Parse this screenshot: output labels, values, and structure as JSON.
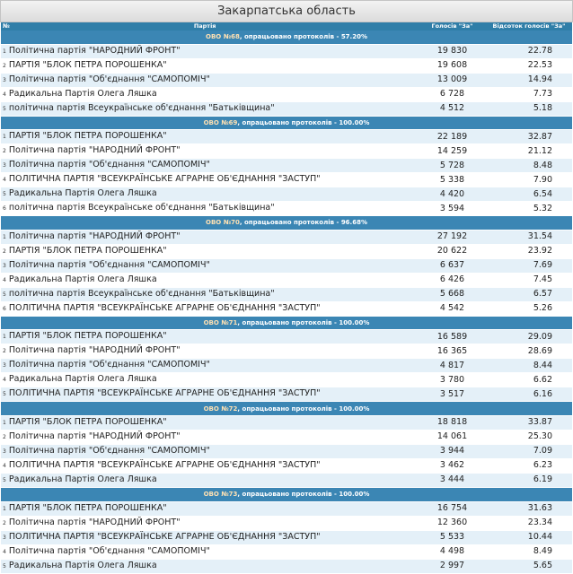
{
  "page_title": "Закарпатська область",
  "columns": {
    "num": "№",
    "party": "Партія",
    "votes": "Голосів \"За\"",
    "percent": "Відсоток голосів \"За\""
  },
  "sections": [
    {
      "name": "ОВО №68",
      "note": ", опрацьовано протоколів - 57.20%",
      "rows": [
        {
          "n": "1",
          "party": "Політична партія \"НАРОДНИЙ ФРОНТ\"",
          "votes": "19 830",
          "pct": "22.78"
        },
        {
          "n": "2",
          "party": "ПАРТІЯ \"БЛОК ПЕТРА ПОРОШЕНКА\"",
          "votes": "19 608",
          "pct": "22.53"
        },
        {
          "n": "3",
          "party": "Політична партія \"Об'єднання \"САМОПОМІЧ\"",
          "votes": "13 009",
          "pct": "14.94"
        },
        {
          "n": "4",
          "party": "Радикальна Партія Олега Ляшка",
          "votes": "6 728",
          "pct": "7.73"
        },
        {
          "n": "5",
          "party": "політична партія Всеукраїнське об'єднання \"Батьківщина\"",
          "votes": "4 512",
          "pct": "5.18"
        }
      ]
    },
    {
      "name": "ОВО №69",
      "note": ", опрацьовано протоколів - 100.00%",
      "rows": [
        {
          "n": "1",
          "party": "ПАРТІЯ \"БЛОК ПЕТРА ПОРОШЕНКА\"",
          "votes": "22 189",
          "pct": "32.87"
        },
        {
          "n": "2",
          "party": "Політична партія \"НАРОДНИЙ ФРОНТ\"",
          "votes": "14 259",
          "pct": "21.12"
        },
        {
          "n": "3",
          "party": "Політична партія \"Об'єднання \"САМОПОМІЧ\"",
          "votes": "5 728",
          "pct": "8.48"
        },
        {
          "n": "4",
          "party": "ПОЛІТИЧНА ПАРТІЯ \"ВСЕУКРАЇНСЬКЕ АГРАРНЕ ОБ'ЄДНАННЯ \"ЗАСТУП\"",
          "votes": "5 338",
          "pct": "7.90"
        },
        {
          "n": "5",
          "party": "Радикальна Партія Олега Ляшка",
          "votes": "4 420",
          "pct": "6.54"
        },
        {
          "n": "6",
          "party": "політична партія Всеукраїнське об'єднання \"Батьківщина\"",
          "votes": "3 594",
          "pct": "5.32"
        }
      ]
    },
    {
      "name": "ОВО №70",
      "note": ", опрацьовано протоколів - 96.68%",
      "rows": [
        {
          "n": "1",
          "party": "Політична партія \"НАРОДНИЙ ФРОНТ\"",
          "votes": "27 192",
          "pct": "31.54"
        },
        {
          "n": "2",
          "party": "ПАРТІЯ \"БЛОК ПЕТРА ПОРОШЕНКА\"",
          "votes": "20 622",
          "pct": "23.92"
        },
        {
          "n": "3",
          "party": "Політична партія \"Об'єднання \"САМОПОМІЧ\"",
          "votes": "6 637",
          "pct": "7.69"
        },
        {
          "n": "4",
          "party": "Радикальна Партія Олега Ляшка",
          "votes": "6 426",
          "pct": "7.45"
        },
        {
          "n": "5",
          "party": "політична партія Всеукраїнське об'єднання \"Батьківщина\"",
          "votes": "5 668",
          "pct": "6.57"
        },
        {
          "n": "6",
          "party": "ПОЛІТИЧНА ПАРТІЯ \"ВСЕУКРАЇНСЬКЕ АГРАРНЕ ОБ'ЄДНАННЯ \"ЗАСТУП\"",
          "votes": "4 542",
          "pct": "5.26"
        }
      ]
    },
    {
      "name": "ОВО №71",
      "note": ", опрацьовано протоколів - 100.00%",
      "rows": [
        {
          "n": "1",
          "party": "ПАРТІЯ \"БЛОК ПЕТРА ПОРОШЕНКА\"",
          "votes": "16 589",
          "pct": "29.09"
        },
        {
          "n": "2",
          "party": "Політична партія \"НАРОДНИЙ ФРОНТ\"",
          "votes": "16 365",
          "pct": "28.69"
        },
        {
          "n": "3",
          "party": "Політична партія \"Об'єднання \"САМОПОМІЧ\"",
          "votes": "4 817",
          "pct": "8.44"
        },
        {
          "n": "4",
          "party": "Радикальна Партія Олега Ляшка",
          "votes": "3 780",
          "pct": "6.62"
        },
        {
          "n": "5",
          "party": "ПОЛІТИЧНА ПАРТІЯ \"ВСЕУКРАЇНСЬКЕ АГРАРНЕ ОБ'ЄДНАННЯ \"ЗАСТУП\"",
          "votes": "3 517",
          "pct": "6.16"
        }
      ]
    },
    {
      "name": "ОВО №72",
      "note": ", опрацьовано протоколів - 100.00%",
      "rows": [
        {
          "n": "1",
          "party": "ПАРТІЯ \"БЛОК ПЕТРА ПОРОШЕНКА\"",
          "votes": "18 818",
          "pct": "33.87"
        },
        {
          "n": "2",
          "party": "Політична партія \"НАРОДНИЙ ФРОНТ\"",
          "votes": "14 061",
          "pct": "25.30"
        },
        {
          "n": "3",
          "party": "Політична партія \"Об'єднання \"САМОПОМІЧ\"",
          "votes": "3 944",
          "pct": "7.09"
        },
        {
          "n": "4",
          "party": "ПОЛІТИЧНА ПАРТІЯ \"ВСЕУКРАЇНСЬКЕ АГРАРНЕ ОБ'ЄДНАННЯ \"ЗАСТУП\"",
          "votes": "3 462",
          "pct": "6.23"
        },
        {
          "n": "5",
          "party": "Радикальна Партія Олега Ляшка",
          "votes": "3 444",
          "pct": "6.19"
        }
      ]
    },
    {
      "name": "ОВО №73",
      "note": ", опрацьовано протоколів - 100.00%",
      "rows": [
        {
          "n": "1",
          "party": "ПАРТІЯ \"БЛОК ПЕТРА ПОРОШЕНКА\"",
          "votes": "16 754",
          "pct": "31.63"
        },
        {
          "n": "2",
          "party": "Політична партія \"НАРОДНИЙ ФРОНТ\"",
          "votes": "12 360",
          "pct": "23.34"
        },
        {
          "n": "3",
          "party": "ПОЛІТИЧНА ПАРТІЯ \"ВСЕУКРАЇНСЬКЕ АГРАРНЕ ОБ'ЄДНАННЯ \"ЗАСТУП\"",
          "votes": "5 533",
          "pct": "10.44"
        },
        {
          "n": "4",
          "party": "Політична партія \"Об'єднання \"САМОПОМІЧ\"",
          "votes": "4 498",
          "pct": "8.49"
        },
        {
          "n": "5",
          "party": "Радикальна Партія Олега Ляшка",
          "votes": "2 997",
          "pct": "5.65"
        }
      ]
    }
  ]
}
